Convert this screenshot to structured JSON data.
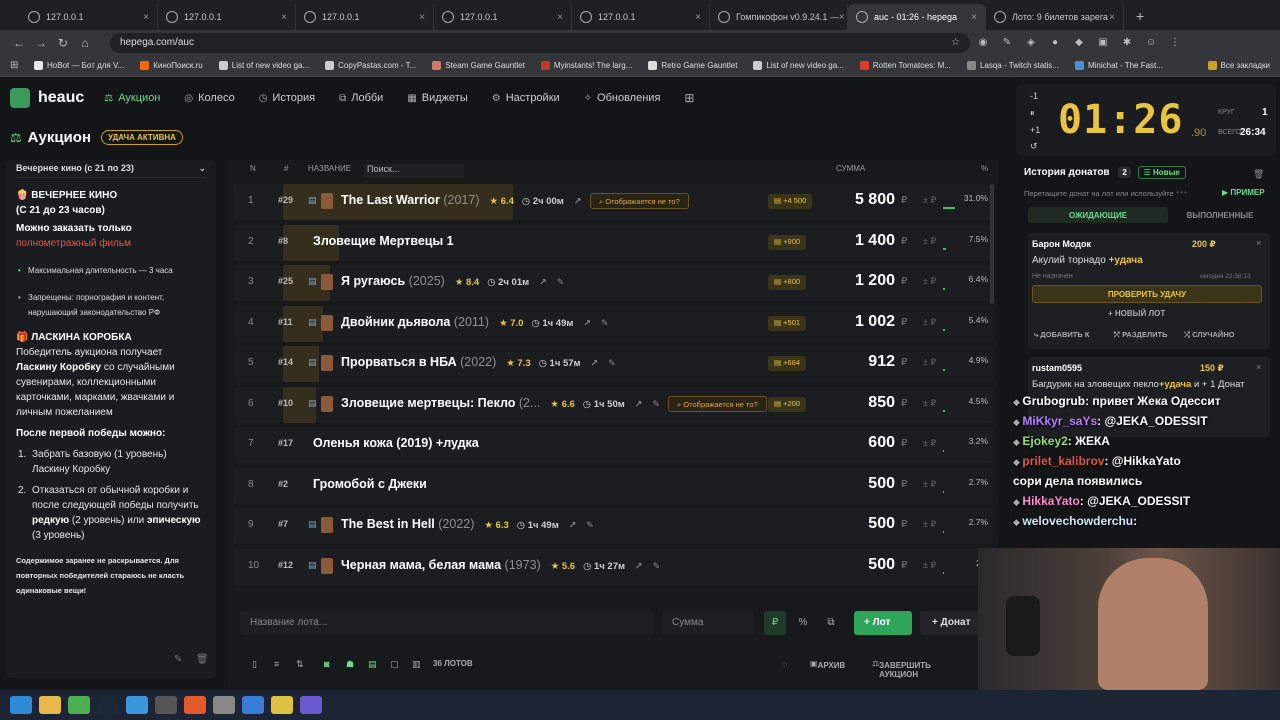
{
  "browser": {
    "tabs": [
      {
        "label": "127.0.0.1"
      },
      {
        "label": "127.0.0.1"
      },
      {
        "label": "127.0.0.1"
      },
      {
        "label": "127.0.0.1"
      },
      {
        "label": "127.0.0.1"
      },
      {
        "label": "Гомпикофон v0.9.24.1 —"
      },
      {
        "label": "auc - 01:26 - hepega"
      },
      {
        "label": "Лото: 9 билетов зарега"
      }
    ],
    "url": "hepega.com/auc",
    "bookmarks": [
      {
        "label": "HoBot — Бот для V...",
        "color": "#e8e8e8"
      },
      {
        "label": "КиноПоиск.ru",
        "color": "#ff6600"
      },
      {
        "label": "List of new video ga...",
        "color": "#cccccc"
      },
      {
        "label": "CopyPastas.com - T...",
        "color": "#cccccc"
      },
      {
        "label": "Steam Game Gauntlet",
        "color": "#d0786a"
      },
      {
        "label": "Myinstants! The larg...",
        "color": "#c0392b"
      },
      {
        "label": "Retro Game Gauntlet",
        "color": "#dddddd"
      },
      {
        "label": "List of new video ga...",
        "color": "#cccccc"
      },
      {
        "label": "Rotten Tomatoes: M...",
        "color": "#e03c28"
      },
      {
        "label": "Lasqa - Twitch statis...",
        "color": "#888888"
      },
      {
        "label": "Minichat - The Fast...",
        "color": "#4a90d9"
      }
    ],
    "all_bookmarks": "Все закладки"
  },
  "app": {
    "logo": "heauc",
    "nav": [
      {
        "label": "Аукцион",
        "icon": "gavel-icon"
      },
      {
        "label": "Колесо",
        "icon": "wheel-icon"
      },
      {
        "label": "История",
        "icon": "history-icon"
      },
      {
        "label": "Лобби",
        "icon": "lobby-icon"
      },
      {
        "label": "Виджеты",
        "icon": "widgets-icon"
      },
      {
        "label": "Настройки",
        "icon": "gear-icon"
      },
      {
        "label": "Обновления",
        "icon": "updates-icon"
      }
    ],
    "page_title": "Аукцион",
    "luck_badge": "УДАЧА АКТИВНА"
  },
  "sidebar": {
    "select": "Вечернее кино (с 21 по 23)",
    "title1": "🍿 ВЕЧЕРНЕЕ КИНО",
    "title1b": "(С 21 до 23 часов)",
    "l1": "Можно заказать только",
    "l1red": "полнометражный фильм",
    "b1": "Максимальная длительность — 3 часа",
    "b2": "Запрещены: порнография и контент, нарушающий законодательство РФ",
    "title2": "🎁 ЛАСКИНА КОРОБКА",
    "p2a": "Победитель аукциона получает",
    "p2b": "Ласкину Коробку",
    "p2c": "со случайными сувенирами, коллекционными карточками, марками, жвачками и личным пожеланием",
    "p3": "После первой победы можно:",
    "o1": "Забрать базовую (1 уровень) Ласкину Коробку",
    "o2a": "Отказаться от обычной коробки и после следующей победы получить",
    "o2b": "редкую",
    "o2c": "(2 уровень) или",
    "o2d": "эпическую",
    "o2e": "(3 уровень)",
    "foot": "Содержимое заранее не раскрывается. Для повторных победителей стараюсь не класть одинаковые вещи!"
  },
  "table": {
    "headers": {
      "n": "N",
      "hash": "#",
      "name": "НАЗВАНИЕ",
      "sum": "СУММА",
      "pct": "%"
    },
    "search_placeholder": "Поиск...",
    "rows": [
      {
        "n": "1",
        "hash": "#29",
        "name": "The Last Warrior",
        "year": "(2017)",
        "rating": "★ 6.4",
        "dur": "◷ 2ч 00м",
        "warn": "Отображается не то?",
        "plus": "+4 500",
        "sum": "5 800",
        "pct": "31.0%",
        "pct_value": 31.0
      },
      {
        "n": "2",
        "hash": "#8",
        "name": "Зловещие Мертвецы 1",
        "year": "",
        "rating": "",
        "dur": "",
        "warn": "",
        "plus": "+900",
        "sum": "1 400",
        "pct": "7.5%",
        "pct_value": 7.5
      },
      {
        "n": "3",
        "hash": "#25",
        "name": "Я ругаюсь",
        "year": "(2025)",
        "rating": "★ 8.4",
        "dur": "◷ 2ч 01м",
        "warn": "",
        "plus": "+800",
        "sum": "1 200",
        "pct": "6.4%",
        "pct_value": 6.4
      },
      {
        "n": "4",
        "hash": "#11",
        "name": "Двойник дьявола",
        "year": "(2011)",
        "rating": "★ 7.0",
        "dur": "◷ 1ч 49м",
        "warn": "",
        "plus": "+501",
        "sum": "1 002",
        "pct": "5.4%",
        "pct_value": 5.4
      },
      {
        "n": "5",
        "hash": "#14",
        "name": "Прорваться в НБА",
        "year": "(2022)",
        "rating": "★ 7.3",
        "dur": "◷ 1ч 57м",
        "warn": "",
        "plus": "+684",
        "sum": "912",
        "pct": "4.9%",
        "pct_value": 4.9
      },
      {
        "n": "6",
        "hash": "#10",
        "name": "Зловещие мертвецы: Пекло",
        "year": "(2...",
        "rating": "★ 6.6",
        "dur": "◷ 1ч 50м",
        "warn": "Отображается не то?",
        "plus": "+200",
        "sum": "850",
        "pct": "4.5%",
        "pct_value": 4.5
      },
      {
        "n": "7",
        "hash": "#17",
        "name": "Оленья кожа (2019) +лудка",
        "year": "",
        "rating": "",
        "dur": "",
        "warn": "",
        "plus": "",
        "sum": "600",
        "pct": "3.2%",
        "pct_value": 3.2
      },
      {
        "n": "8",
        "hash": "#2",
        "name": "Громобой с Джеки",
        "year": "",
        "rating": "",
        "dur": "",
        "warn": "",
        "plus": "",
        "sum": "500",
        "pct": "2.7%",
        "pct_value": 2.7
      },
      {
        "n": "9",
        "hash": "#7",
        "name": "The Best in Hell",
        "year": "(2022)",
        "rating": "★ 6.3",
        "dur": "◷ 1ч 49м",
        "warn": "",
        "plus": "",
        "sum": "500",
        "pct": "2.7%",
        "pct_value": 2.7
      },
      {
        "n": "10",
        "hash": "#12",
        "name": "Черная мама, белая мама",
        "year": "(1973)",
        "rating": "★ 5.6",
        "dur": "◷ 1ч 27м",
        "warn": "",
        "plus": "",
        "sum": "500",
        "pct": "2.7",
        "pct_value": 2.7
      }
    ],
    "currency": "₽",
    "pm": "± ₽"
  },
  "bottom": {
    "lot_placeholder": "Название лота...",
    "sum_placeholder": "Сумма",
    "rub": "₽",
    "percent": "%",
    "add_lot": "+ Лот",
    "donate": "+ Донат",
    "lots_count": "36 ЛОТОВ",
    "archive": "АРХИВ",
    "finish": "ЗАВЕРШИТЬ АУКЦИОН"
  },
  "timer": {
    "time": "01:26",
    "ms": ".90",
    "ctl_minus": "-1",
    "ctl_plus": "+1",
    "round_label": "КРУГ",
    "round": "1",
    "total_label": "ВСЕГО",
    "total": "26:34"
  },
  "donations": {
    "title": "История донатов",
    "count": "2",
    "new_label": "Новые",
    "hint": "Перетащите донат на лот или используйте",
    "example": "▶ ПРИМЕР",
    "tab_pending": "ОЖИДАЮЩИЕ",
    "tab_done": "ВЫПОЛНЕННЫЕ",
    "card1": {
      "name": "Барон Модок",
      "amount": "200 ₽",
      "text": "Акулий торнадо",
      "luck": "+удача",
      "status": "Не назначен",
      "time": "сегодня 22:38:13",
      "check": "ПРОВЕРИТЬ УДАЧУ",
      "new_lot": "+ НОВЫЙ ЛОТ",
      "add_to": "ДОБАВИТЬ К",
      "split": "РАЗДЕЛИТЬ",
      "random": "СЛУЧАЙНО"
    },
    "card2": {
      "name": "rustam0595",
      "amount": "150 ₽",
      "text": "Багдурик на зловещих пекло",
      "luck": "+удача",
      "rest": "и + 1 Донат"
    }
  },
  "chat": [
    {
      "user": "Grubogrub",
      "color": "#ffffff",
      "msg": ": привет Жека Одессит"
    },
    {
      "user": "MiKkyr_saYs",
      "color": "#b77cff",
      "msg": ": @JEKA_ODESSIT"
    },
    {
      "user": "Ejokey2",
      "color": "#8fe07a",
      "msg": ": ЖЕКА"
    },
    {
      "user": "prilet_kalibrov",
      "color": "#e0554a",
      "msg": ": @HikkaYato"
    },
    {
      "user": "",
      "color": "#ffffff",
      "msg": "сори дела появились"
    },
    {
      "user": "HikkaYato",
      "color": "#ff8ad8",
      "msg": ": @JEKA_ODESSIT"
    },
    {
      "user": "welovechowderchu",
      "color": "#cfe8ff",
      "msg": ":"
    }
  ]
}
